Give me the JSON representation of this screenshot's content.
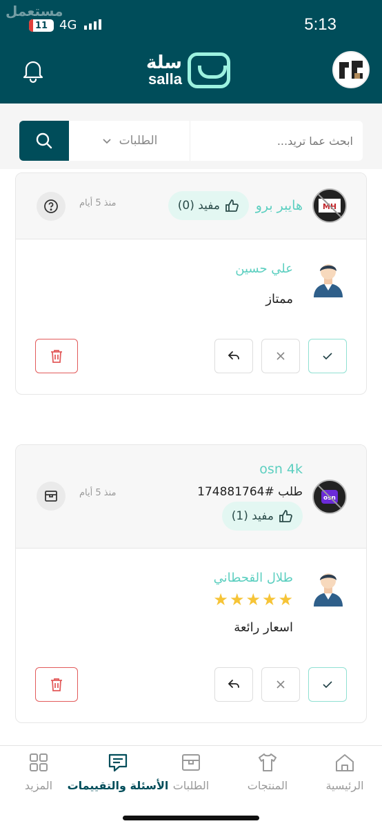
{
  "status_bar": {
    "watermark": "مستعمل",
    "battery": "11",
    "network": "4G",
    "time": "5:13"
  },
  "header": {
    "logo_arabic": "سلة",
    "logo_latin": "salla"
  },
  "search": {
    "placeholder": "ابحث عما تريد...",
    "filter_label": "الطلبات"
  },
  "reviews": [
    {
      "product_name": "هايبر برو",
      "helpful_label": "مفيد (0)",
      "age": "منذ 5 أيام",
      "type": "question",
      "user_name": "علي حسين",
      "comment": "ممتاز"
    },
    {
      "product_name": "osn 4k",
      "order_ref": "طلب #174881764",
      "helpful_label": "مفيد (1)",
      "age": "منذ 5 أيام",
      "type": "order",
      "user_name": "طلال القحطاني",
      "rating": 5,
      "comment": "اسعار رائعة"
    }
  ],
  "colors": {
    "primary": "#004d5a",
    "accent": "#5ccfc0",
    "star": "#f6c437",
    "danger": "#e25a5a"
  },
  "bottom_nav": {
    "home": "الرئيسية",
    "products": "المنتجات",
    "orders": "الطلبات",
    "reviews": "الأسئلة والتقييمات",
    "more": "المزيد",
    "active": "reviews"
  }
}
